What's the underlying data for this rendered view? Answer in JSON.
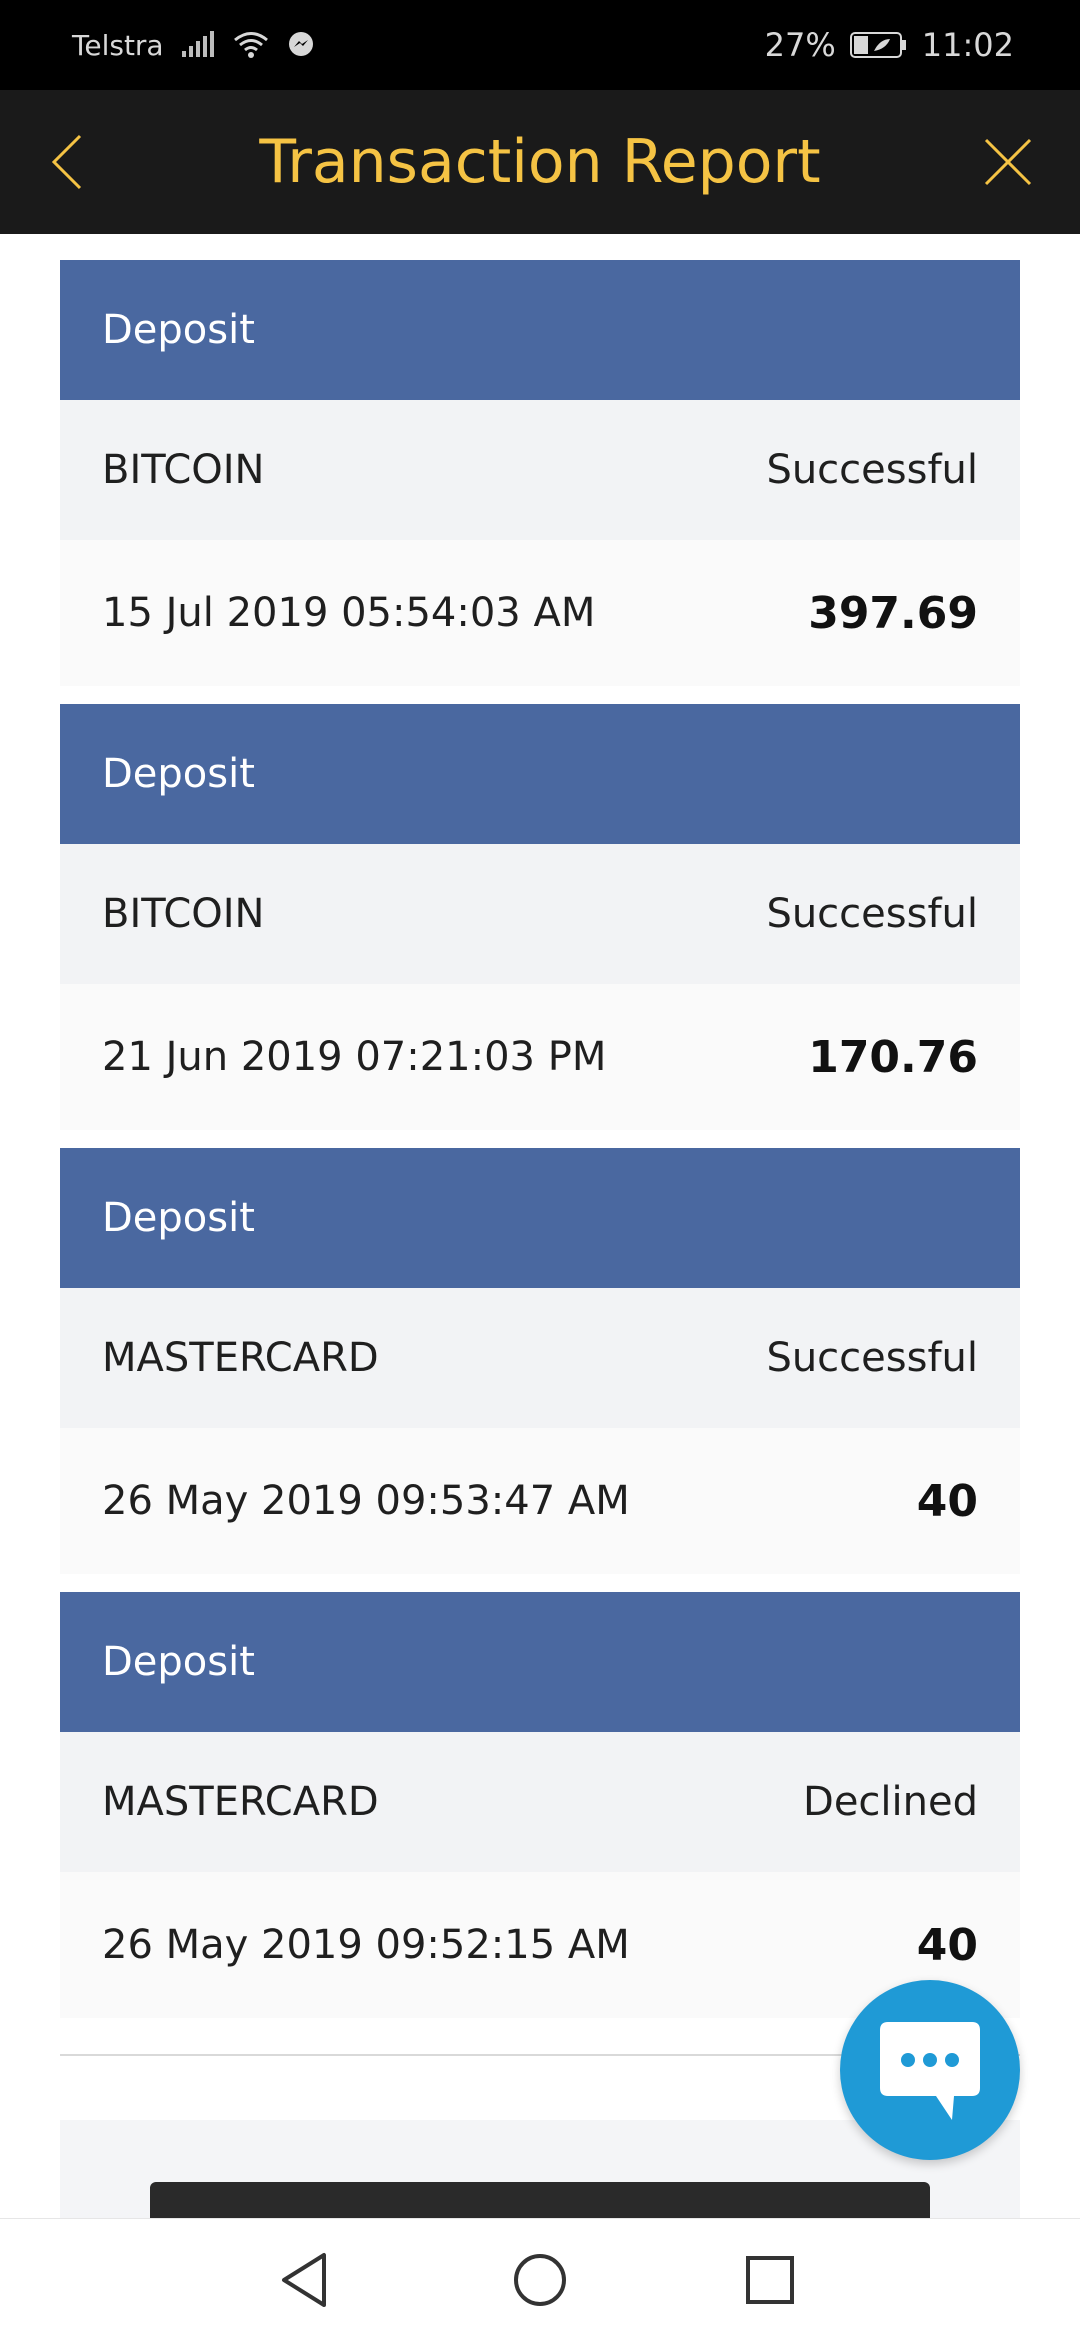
{
  "status_bar": {
    "carrier": "Telstra",
    "battery": "27%",
    "time": "11:02"
  },
  "header": {
    "title": "Transaction Report"
  },
  "transactions": [
    {
      "type": "Deposit",
      "method": "BITCOIN",
      "status": "Successful",
      "datetime": "15 Jul 2019 05:54:03 AM",
      "amount": "397.69"
    },
    {
      "type": "Deposit",
      "method": "BITCOIN",
      "status": "Successful",
      "datetime": "21 Jun 2019 07:21:03 PM",
      "amount": "170.76"
    },
    {
      "type": "Deposit",
      "method": "MASTERCARD",
      "status": "Successful",
      "datetime": "26 May 2019 09:53:47 AM",
      "amount": "40"
    },
    {
      "type": "Deposit",
      "method": "MASTERCARD",
      "status": "Declined",
      "datetime": "26 May 2019 09:52:15 AM",
      "amount": "40"
    }
  ],
  "colors": {
    "status_bar_bg": "#000000",
    "header_bg": "#1a1a1a",
    "title_color": "#f5c344",
    "card_head_bg": "#4a68a0",
    "chat_fab_bg": "#1f9ad6"
  },
  "icons": {
    "back": "chevron-left-icon",
    "close": "close-icon",
    "chat": "chat-bubble-icon",
    "nav_back": "triangle-back-icon",
    "nav_home": "circle-home-icon",
    "nav_recent": "square-recent-icon"
  }
}
